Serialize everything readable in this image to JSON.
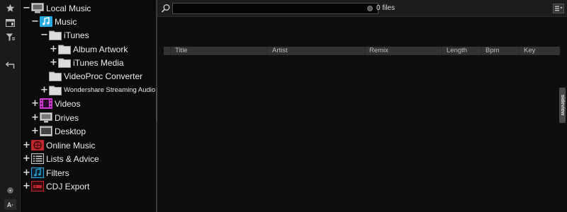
{
  "sidebar_icons": [
    {
      "name": "favorites-star-icon"
    },
    {
      "name": "browser-icon"
    },
    {
      "name": "filter-icon"
    },
    {
      "name": "back-icon"
    },
    {
      "name": "small-dot-icon"
    },
    {
      "name": "font-size-icon",
      "label": "A·"
    }
  ],
  "tree": {
    "items": [
      {
        "label": "Local Music",
        "toggle": "−",
        "icon": "computer-icon"
      },
      {
        "label": "Music",
        "toggle": "−",
        "icon": "music-folder-icon"
      },
      {
        "label": "iTunes",
        "toggle": "−",
        "icon": "folder-icon"
      },
      {
        "label": "Album Artwork",
        "toggle": "+",
        "icon": "folder-icon"
      },
      {
        "label": "iTunes Media",
        "toggle": "+",
        "icon": "folder-icon"
      },
      {
        "label": "VideoProc Converter",
        "toggle": "",
        "icon": "folder-icon"
      },
      {
        "label": "Wondershare Streaming Audio Recorder",
        "toggle": "+",
        "icon": "folder-icon"
      },
      {
        "label": "Videos",
        "toggle": "+",
        "icon": "videos-icon"
      },
      {
        "label": "Drives",
        "toggle": "+",
        "icon": "drive-icon"
      },
      {
        "label": "Desktop",
        "toggle": "+",
        "icon": "desktop-icon"
      },
      {
        "label": "Online Music",
        "toggle": "+",
        "icon": "online-music-icon"
      },
      {
        "label": "Lists & Advice",
        "toggle": "+",
        "icon": "list-icon"
      },
      {
        "label": "Filters",
        "toggle": "+",
        "icon": "filter-folder-icon"
      },
      {
        "label": "CDJ Export",
        "toggle": "+",
        "icon": "cdj-export-icon"
      }
    ]
  },
  "folders_tab": {
    "label": "folders"
  },
  "sideview_tab": {
    "label": "sideview"
  },
  "search": {
    "value": "",
    "placeholder": ""
  },
  "file_count": {
    "text": "0 files"
  },
  "columns": [
    "Title",
    "Artist",
    "Remix",
    "Length",
    "Bpm",
    "Key"
  ],
  "colors": {
    "music_accent": "#2aa8e0",
    "videos_accent": "#d43bd4",
    "online_accent": "#c0262d",
    "filters_accent": "#2aa8e0"
  }
}
